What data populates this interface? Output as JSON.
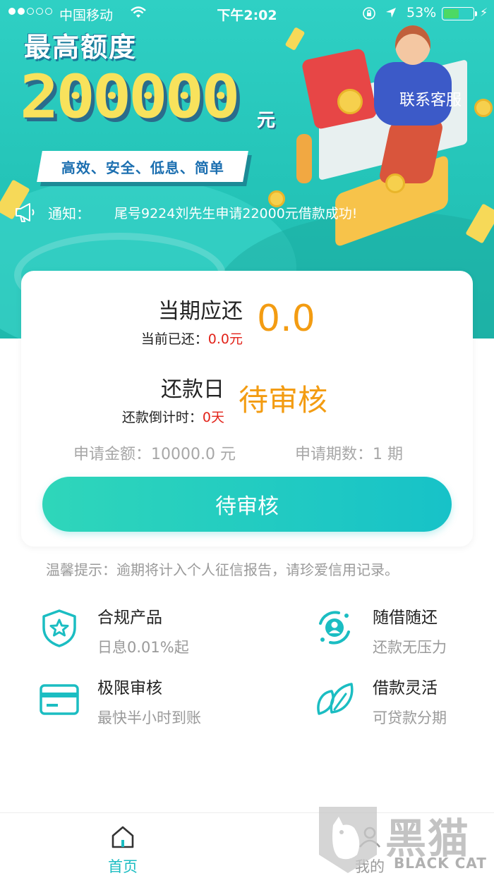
{
  "status_bar": {
    "carrier": "中国移动",
    "time": "下午2:02",
    "battery_percent": "53%",
    "battery_level": 0.53
  },
  "banner": {
    "title": "最高额度",
    "amount": "200000",
    "unit": "元",
    "tagline": "高效、安全、低息、简单",
    "contact_label": "联系客服"
  },
  "notice": {
    "label": "通知：",
    "message": "尾号9224刘先生申请22000元借款成功!"
  },
  "card": {
    "current_due_label": "当期应还",
    "current_due_value": "0.0",
    "paid_label": "当前已还：",
    "paid_value": "0.0元",
    "due_date_label": "还款日",
    "due_date_value": "待审核",
    "countdown_label": "还款倒计时：",
    "countdown_value": "0天",
    "apply_amount": "申请金额：10000.0 元",
    "apply_periods": "申请期数：1 期",
    "button_label": "待审核"
  },
  "tip": "温馨提示：逾期将计入个人征信报告，请珍爱信用记录。",
  "features": [
    {
      "title": "合规产品",
      "desc": "日息0.01%起",
      "icon": "shield-star-icon"
    },
    {
      "title": "随借随还",
      "desc": "还款无压力",
      "icon": "user-cycle-icon"
    },
    {
      "title": "极限审核",
      "desc": "最快半小时到账",
      "icon": "card-icon"
    },
    {
      "title": "借款灵活",
      "desc": "可贷款分期",
      "icon": "leaf-icon"
    }
  ],
  "tabbar": {
    "home_label": "首页",
    "mine_label": "我的"
  },
  "watermark": {
    "cn": "黑猫",
    "en": "BLACK CAT"
  },
  "colors": {
    "teal": "#1bbdc2",
    "orange": "#f39c12",
    "red": "#e2231a"
  }
}
